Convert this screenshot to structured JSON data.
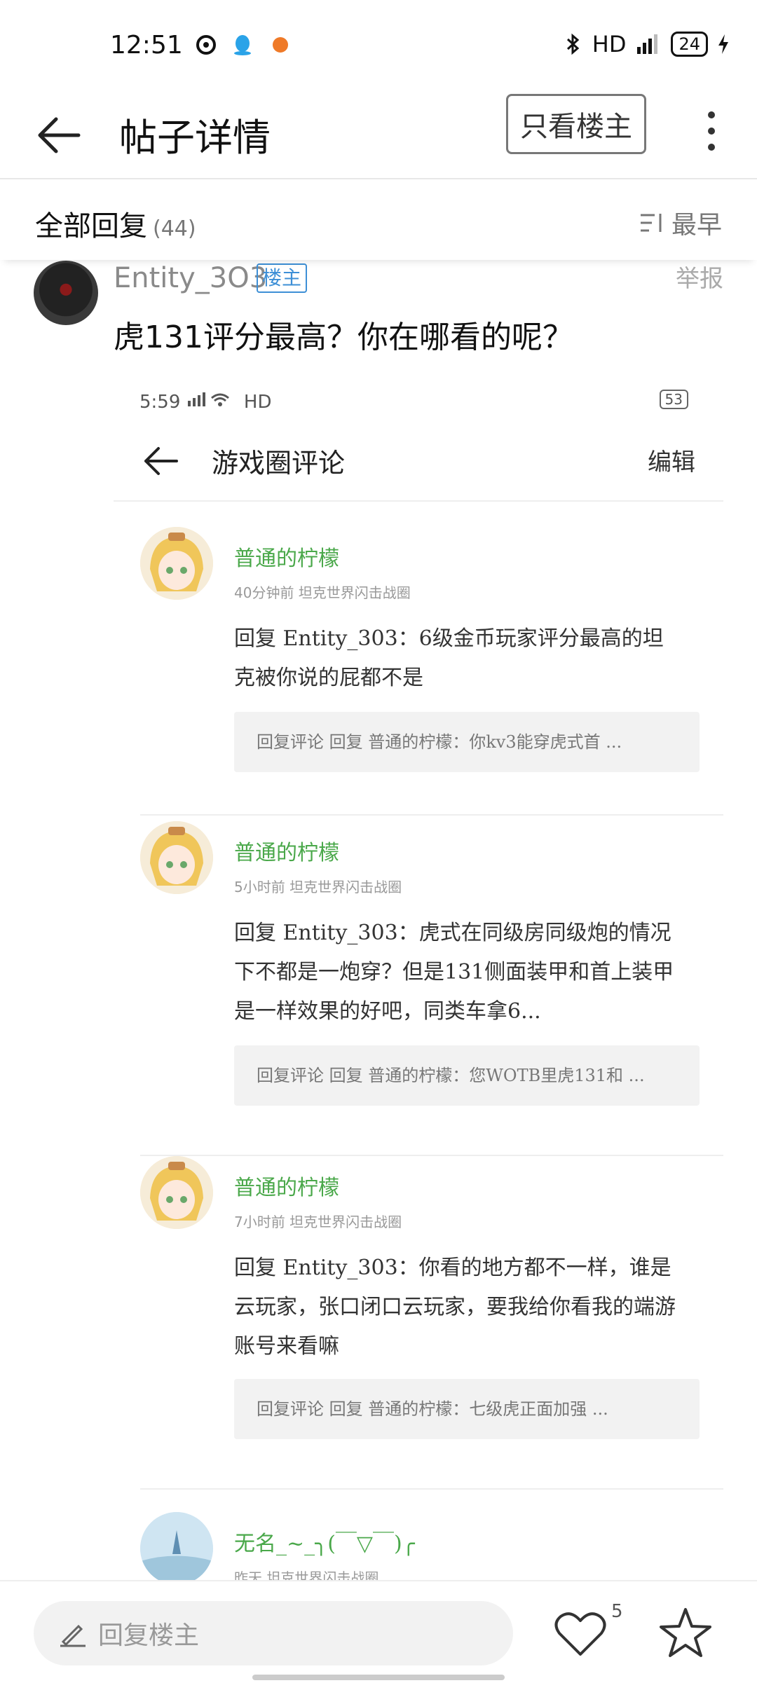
{
  "status_bar": {
    "time": "12:51",
    "network": "HD",
    "battery": "24"
  },
  "app_bar": {
    "title": "帖子详情",
    "owner_only_button": "只看楼主"
  },
  "reply_header": {
    "label": "全部回复",
    "count": "(44)",
    "sort_label": "最早"
  },
  "post": {
    "username": "Entity_3O3",
    "badge": "楼主",
    "report_label": "举报",
    "text": "虎131评分最高？你在哪看的呢？"
  },
  "embedded_screenshot": {
    "status_time": "5:59",
    "status_network": "HD",
    "battery": "53",
    "title": "游戏圈评论",
    "edit_label": "编辑",
    "comments": [
      {
        "name": "普通的柠檬",
        "meta": "40分钟前    坦克世界闪击战圈",
        "text": "回复 Entity_303：6级金币玩家评分最高的坦克被你说的屁都不是",
        "reply": "回复评论 回复 普通的柠檬：你kv3能穿虎式首 ..."
      },
      {
        "name": "普通的柠檬",
        "meta": "5小时前    坦克世界闪击战圈",
        "text": "回复 Entity_303：虎式在同级房同级炮的情况下不都是一炮穿？但是131侧面装甲和首上装甲是一样效果的好吧，同类车拿6...",
        "reply": "回复评论 回复 普通的柠檬：您WOTB里虎131和 ..."
      },
      {
        "name": "普通的柠檬",
        "meta": "7小时前    坦克世界闪击战圈",
        "text": "回复 Entity_303：你看的地方都不一样，谁是云玩家，张口闭口云玩家，要我给你看我的端游账号来看嘛",
        "reply": "回复评论 回复 普通的柠檬：七级虎正面加强 ..."
      },
      {
        "name": "无名_~_╮(￣▽￣)╭",
        "meta": "昨天    坦克世界闪击战圈",
        "text": "",
        "reply": ""
      }
    ]
  },
  "bottom_bar": {
    "reply_placeholder": "回复楼主",
    "like_count": "5"
  }
}
